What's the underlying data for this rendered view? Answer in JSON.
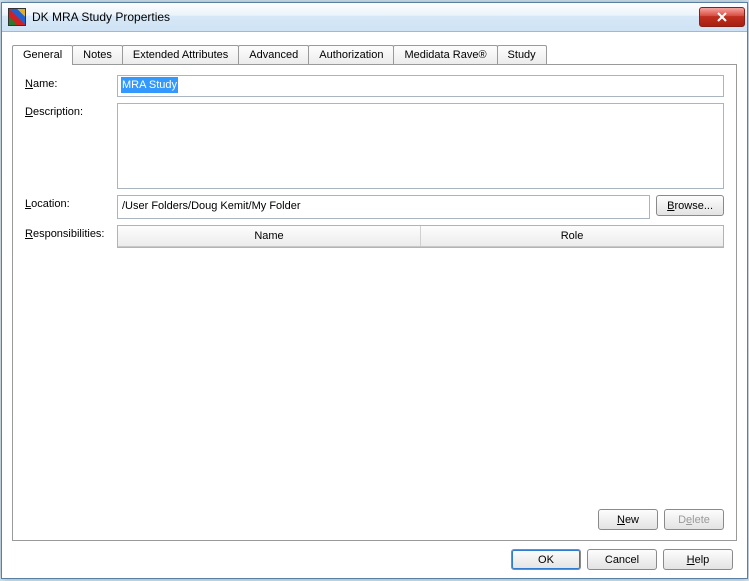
{
  "window": {
    "title": "DK MRA Study Properties"
  },
  "tabs": [
    "General",
    "Notes",
    "Extended Attributes",
    "Advanced",
    "Authorization",
    "Medidata Rave®",
    "Study"
  ],
  "active_tab": 0,
  "labels": {
    "name": "Name:",
    "description": "Description:",
    "location": "Location:",
    "responsibilities": "Responsibilities:"
  },
  "fields": {
    "name": "MRA Study",
    "description": "",
    "location": "/User Folders/Doug Kemit/My Folder"
  },
  "responsibilities": {
    "columns": [
      "Name",
      "Role"
    ],
    "rows": []
  },
  "buttons": {
    "browse": "Browse...",
    "new": "New",
    "delete": "Delete",
    "ok": "OK",
    "cancel": "Cancel",
    "help": "Help"
  },
  "accesskeys": {
    "name": "N",
    "description": "D",
    "location": "L",
    "responsibilities": "R",
    "browse": "B",
    "new": "N",
    "delete": "e",
    "help": "H"
  }
}
